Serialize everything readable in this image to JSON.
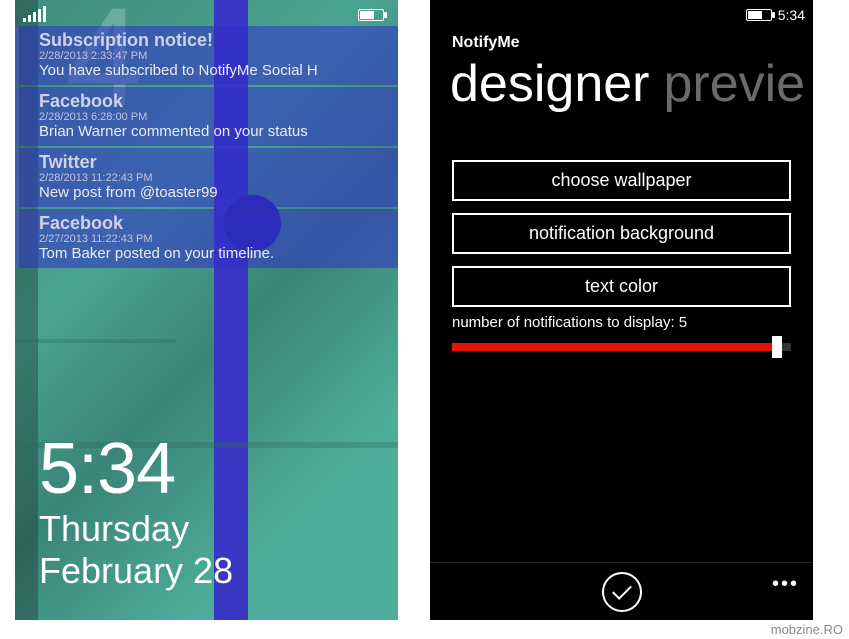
{
  "watermark": "mobzine.RO",
  "left": {
    "bg_digit": "4",
    "status": {
      "time": ""
    },
    "notifications": [
      {
        "title": "Subscription notice!",
        "ts": "2/28/2013 2:33:47 PM",
        "body": "You have subscribed to NotifyMe Social H"
      },
      {
        "title": "Facebook",
        "ts": "2/28/2013 6:28:00 PM",
        "body": "Brian Warner commented on your status"
      },
      {
        "title": "Twitter",
        "ts": "2/28/2013 11:22:43 PM",
        "body": "New post from @toaster99"
      },
      {
        "title": "Facebook",
        "ts": "2/27/2013 11:22:43 PM",
        "body": "Tom Baker posted on your timeline."
      }
    ],
    "clock": {
      "time": "5:34",
      "day": "Thursday",
      "date": "February 28"
    }
  },
  "right": {
    "status": {
      "time": "5:34"
    },
    "app_name": "NotifyMe",
    "pivot": {
      "active": "designer",
      "inactive": "previe"
    },
    "buttons": {
      "wallpaper": "choose wallpaper",
      "notif_bg": "notification background",
      "text_color": "text color"
    },
    "slider": {
      "label": "number of notifications to display: 5",
      "value_pct": 96
    }
  }
}
